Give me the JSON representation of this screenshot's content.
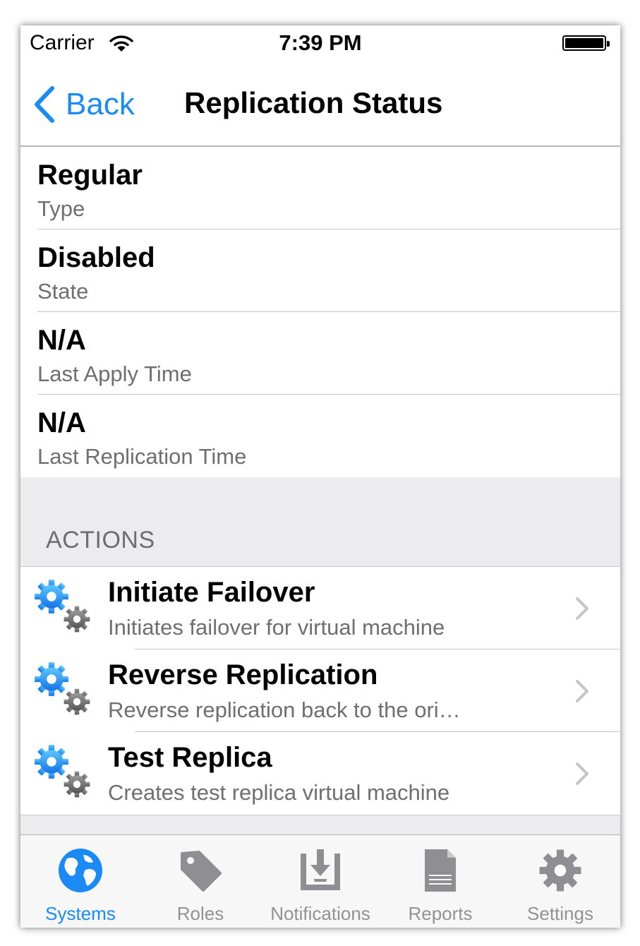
{
  "status_bar": {
    "carrier": "Carrier",
    "time": "7:39 PM"
  },
  "nav": {
    "back_label": "Back",
    "title": "Replication Status"
  },
  "details": [
    {
      "value": "Regular",
      "label": "Type"
    },
    {
      "value": "Disabled",
      "label": "State"
    },
    {
      "value": "N/A",
      "label": "Last Apply Time"
    },
    {
      "value": "N/A",
      "label": "Last Replication Time"
    }
  ],
  "actions_section": {
    "header": "ACTIONS",
    "items": [
      {
        "title": "Initiate Failover",
        "subtitle": "Initiates failover for virtual machine",
        "icon": "gears-icon"
      },
      {
        "title": "Reverse Replication",
        "subtitle": "Reverse replication back to the ori…",
        "icon": "gears-icon"
      },
      {
        "title": "Test Replica",
        "subtitle": "Creates test replica virtual machine",
        "icon": "gears-icon"
      }
    ]
  },
  "tab_bar": {
    "items": [
      {
        "label": "Systems",
        "icon": "globe-icon",
        "active": true
      },
      {
        "label": "Roles",
        "icon": "tag-icon",
        "active": false
      },
      {
        "label": "Notifications",
        "icon": "inbox-download-icon",
        "active": false
      },
      {
        "label": "Reports",
        "icon": "document-icon",
        "active": false
      },
      {
        "label": "Settings",
        "icon": "gear-icon",
        "active": false
      }
    ]
  },
  "colors": {
    "accent": "#1a8bf5",
    "section_bg": "#ececee",
    "inactive_tab": "#929292",
    "secondary_text": "#6e6e73"
  }
}
